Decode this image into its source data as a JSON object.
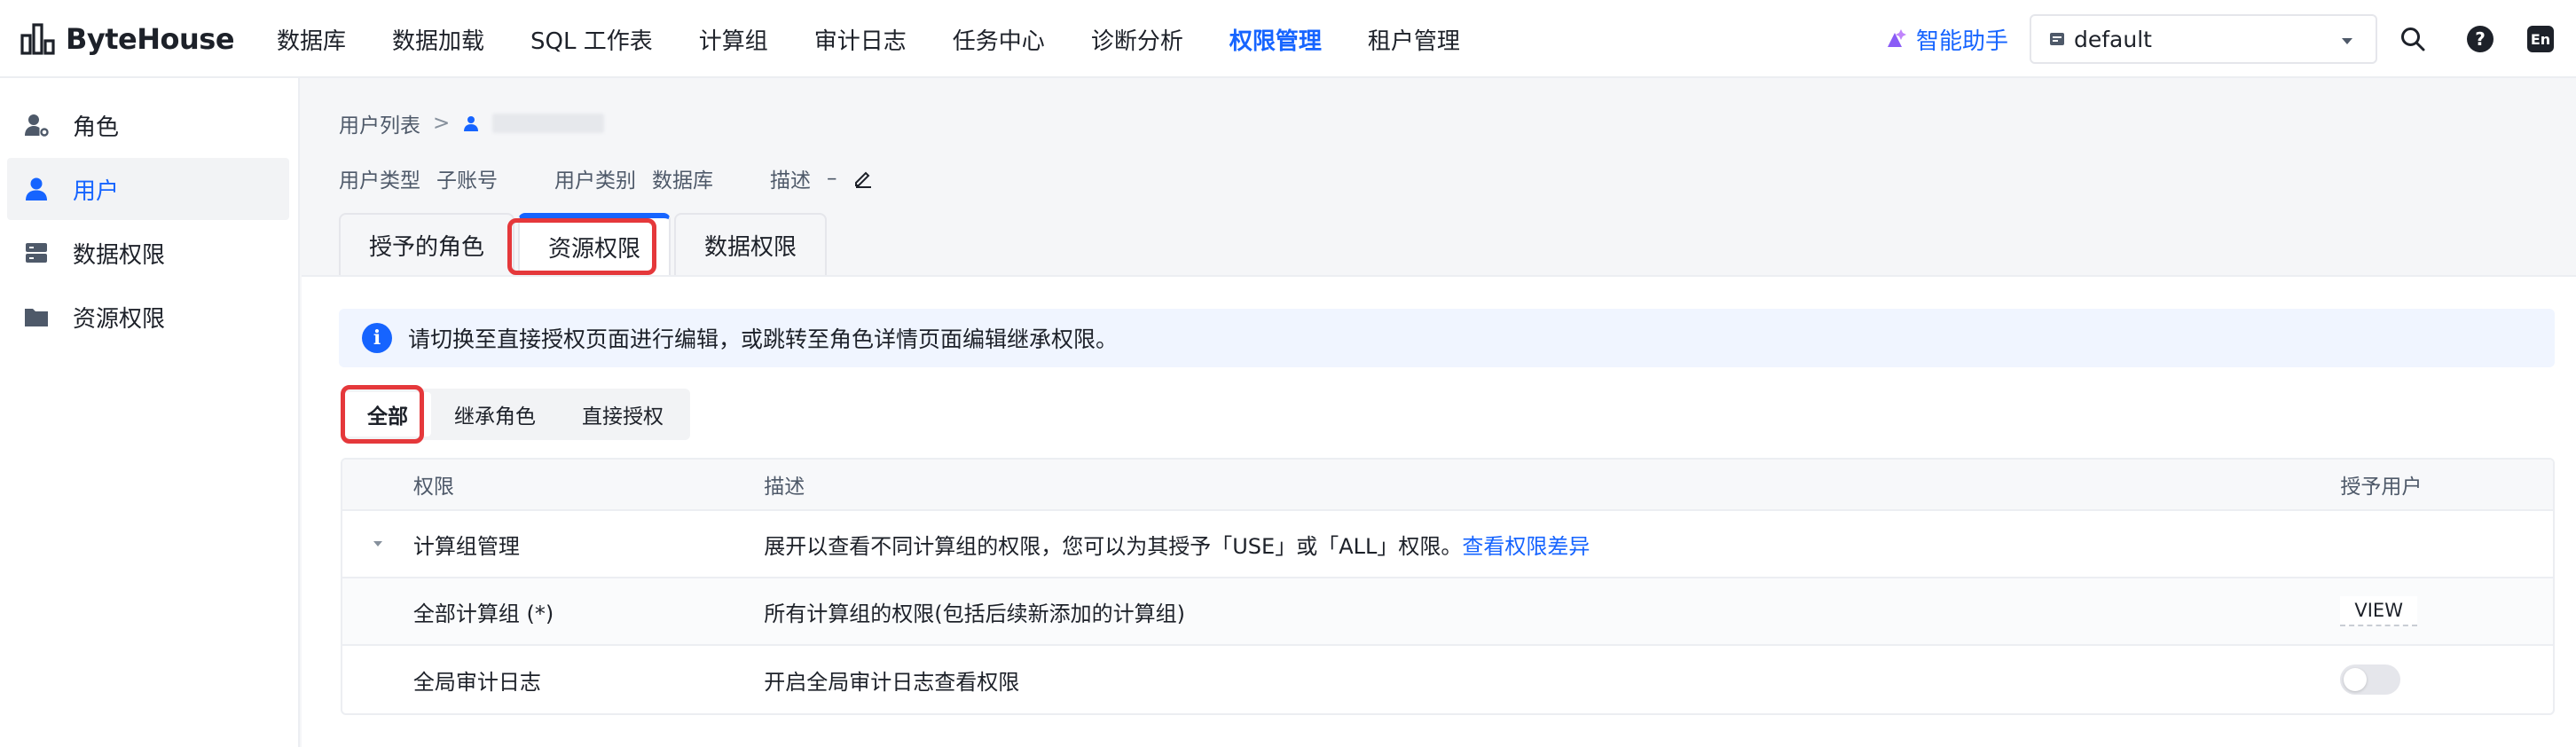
{
  "app": {
    "name": "ByteHouse"
  },
  "nav": [
    {
      "label": "数据库"
    },
    {
      "label": "数据加载"
    },
    {
      "label": "SQL 工作表"
    },
    {
      "label": "计算组"
    },
    {
      "label": "审计日志"
    },
    {
      "label": "任务中心"
    },
    {
      "label": "诊断分析"
    },
    {
      "label": "权限管理",
      "active": true
    },
    {
      "label": "租户管理"
    }
  ],
  "header": {
    "assistant_label": "智能助手",
    "workspace_value": "default",
    "lang_label": "En",
    "help_label": "?"
  },
  "sidebar": [
    {
      "label": "角色",
      "icon": "user-gear-icon"
    },
    {
      "label": "用户",
      "icon": "user-icon",
      "active": true
    },
    {
      "label": "数据权限",
      "icon": "database-icon"
    },
    {
      "label": "资源权限",
      "icon": "folder-icon"
    }
  ],
  "breadcrumb": {
    "parent": "用户列表",
    "separator": ">"
  },
  "user_meta": {
    "type_label": "用户类型",
    "type_value": "子账号",
    "category_label": "用户类别",
    "category_value": "数据库",
    "desc_label": "描述",
    "desc_value": "–"
  },
  "tabs": [
    {
      "label": "授予的角色"
    },
    {
      "label": "资源权限",
      "active": true
    },
    {
      "label": "数据权限"
    }
  ],
  "alert": {
    "icon_text": "i",
    "text": "请切换至直接授权页面进行编辑，或跳转至角色详情页面编辑继承权限。"
  },
  "filters": [
    {
      "label": "全部",
      "active": true
    },
    {
      "label": "继承角色"
    },
    {
      "label": "直接授权"
    }
  ],
  "table": {
    "headers": {
      "permission": "权限",
      "description": "描述",
      "grant": "授予用户"
    },
    "rows": [
      {
        "permission": "计算组管理",
        "description": "展开以查看不同计算组的权限，您可以为其授予「USE」或「ALL」权限。",
        "link": "查看权限差异",
        "expanded": true
      },
      {
        "permission": "全部计算组 (*)",
        "description": "所有计算组的权限(包括后续新添加的计算组)",
        "grant": "VIEW"
      },
      {
        "permission": "全局审计日志",
        "description": "开启全局审计日志查看权限",
        "grant_toggle": false
      }
    ]
  },
  "colors": {
    "accent": "#1664ff",
    "highlight": "#e5383b",
    "assistant_icon": "#8a5cf6"
  }
}
